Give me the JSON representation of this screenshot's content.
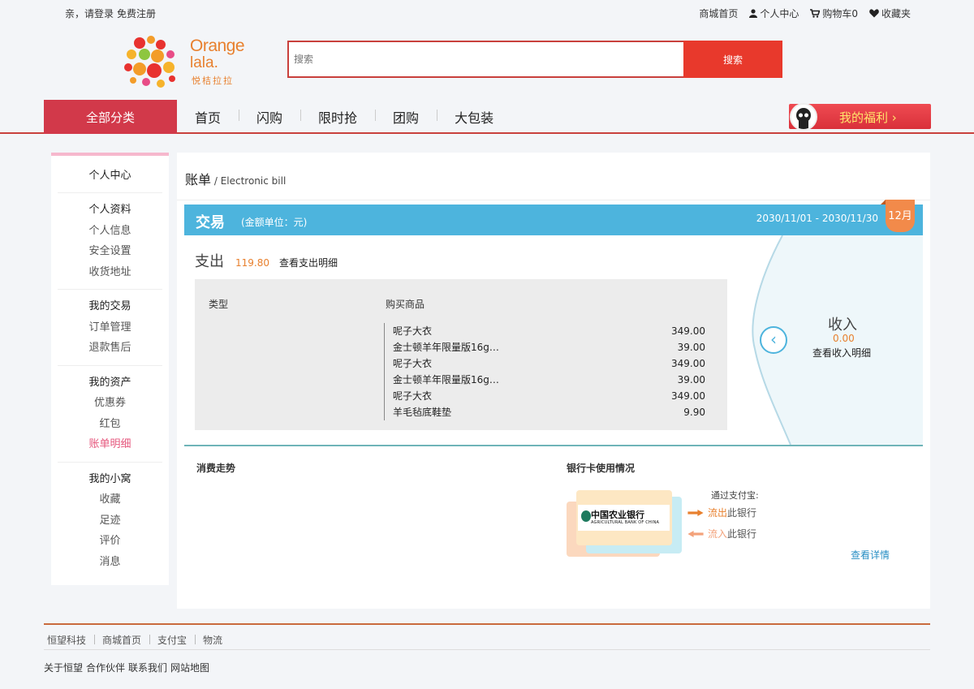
{
  "topbar": {
    "greeting": "亲，请登录",
    "register": "免费注册",
    "links": [
      {
        "label": "商城首页",
        "icon": ""
      },
      {
        "label": "个人中心",
        "icon": "user-icon"
      },
      {
        "label": "购物车0",
        "icon": "cart-icon"
      },
      {
        "label": "收藏夹",
        "icon": "heart-icon"
      }
    ]
  },
  "logo": {
    "line1": "Orange",
    "line2": "lala.",
    "cn": "悦桔拉拉"
  },
  "search": {
    "placeholder": "搜索",
    "button": "搜索"
  },
  "nav": {
    "all_categories": "全部分类",
    "items": [
      "首页",
      "闪购",
      "限时抢",
      "团购",
      "大包装"
    ],
    "welfare": "我的福利 ›"
  },
  "sidebar": {
    "title": "个人中心",
    "groups": [
      {
        "title": "个人资料",
        "items": [
          "个人信息",
          "安全设置",
          "收货地址"
        ]
      },
      {
        "title": "我的交易",
        "items": [
          "订单管理",
          "退款售后"
        ]
      },
      {
        "title": "我的资产",
        "items": [
          "优惠券",
          "红包",
          "账单明细"
        ]
      },
      {
        "title": "我的小窝",
        "items": [
          "收藏",
          "足迹",
          "评价",
          "消息"
        ]
      }
    ],
    "active": "账单明细"
  },
  "bill": {
    "title": "账单",
    "subtitle": " / Electronic bill",
    "trans_label": "交易",
    "unit": "(金额单位：元)",
    "date_range": "2030/11/01 - 2030/11/30",
    "month": "12月",
    "expense_label": "支出",
    "expense_amount": "119.80",
    "expense_link": "查看支出明细",
    "col_type": "类型",
    "col_goods": "购买商品",
    "rows": [
      {
        "name": "呢子大衣",
        "price": "349.00"
      },
      {
        "name": "金士顿羊年限量版16g…",
        "price": "39.00"
      },
      {
        "name": "呢子大衣",
        "price": "349.00"
      },
      {
        "name": "金士顿羊年限量版16g…",
        "price": "39.00"
      },
      {
        "name": "呢子大衣",
        "price": "349.00"
      },
      {
        "name": "羊毛毡底鞋垫",
        "price": "9.90"
      }
    ],
    "income_label": "收入",
    "income_amount": "0.00",
    "income_link": "查看收入明细",
    "trend_title": "消费走势",
    "bank_title": "银行卡使用情况",
    "bank_name": "中国农业银行",
    "bank_en": "AGRICULTURAL BANK OF CHINA",
    "via": "通过支付宝:",
    "out_highlight": "流出",
    "out_rest": "此银行",
    "in_highlight": "流入",
    "in_rest": "此银行",
    "detail_link": "查看详情"
  },
  "footer": {
    "links": [
      "恒望科技",
      "商城首页",
      "支付宝",
      "物流"
    ],
    "bottom": [
      "关于恒望",
      "合作伙伴",
      "联系我们",
      "网站地图"
    ]
  },
  "colors": {
    "accent": "#c9403c",
    "blue": "#4db4dd",
    "orange": "#e8802e",
    "pink": "#e5567c"
  }
}
